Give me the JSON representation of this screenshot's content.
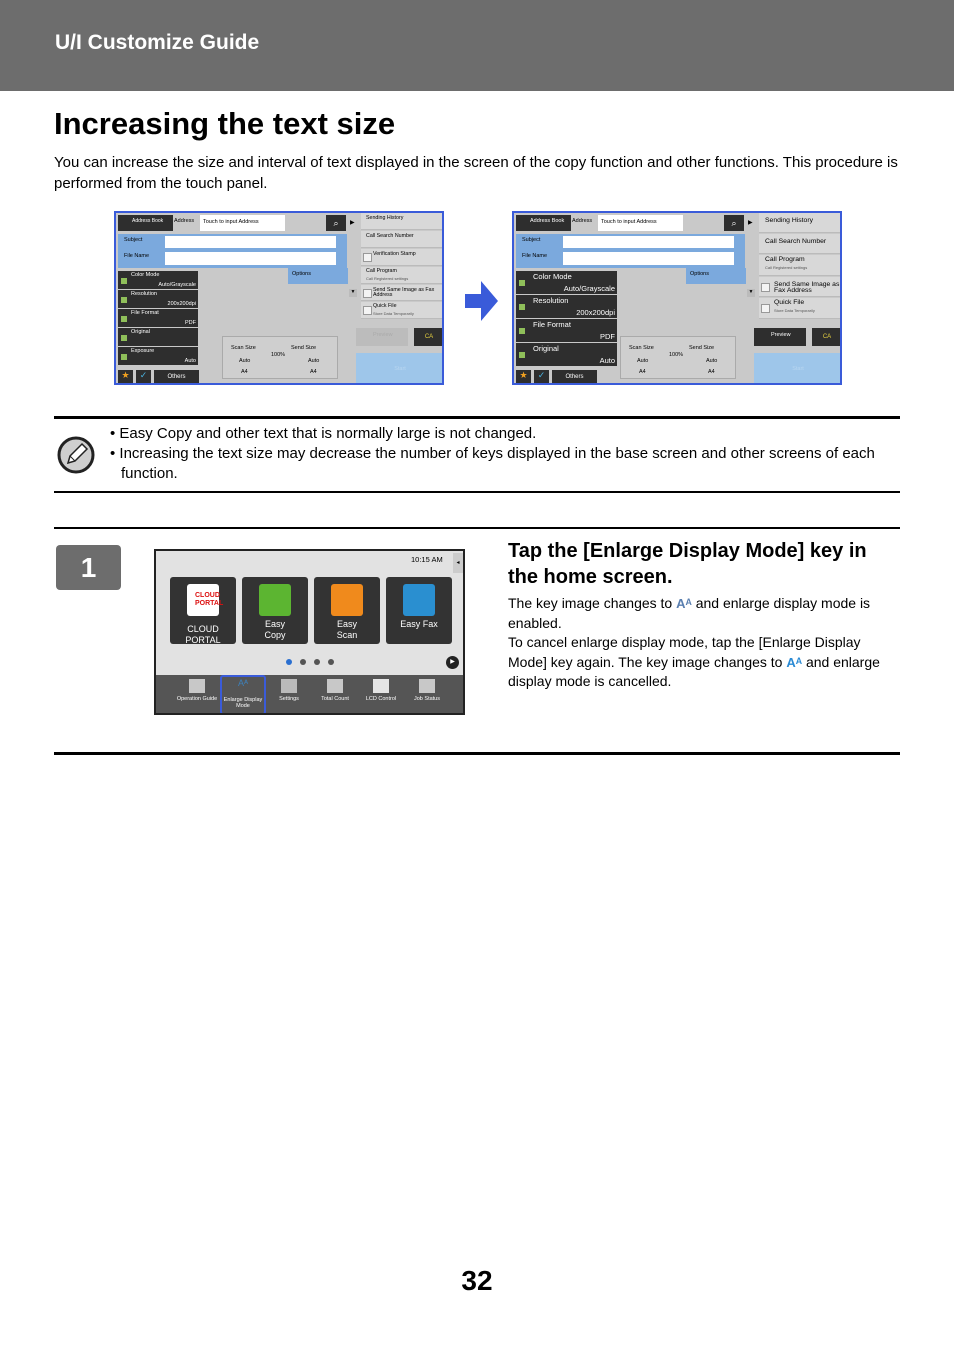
{
  "header": {
    "title": "U/I Customize Guide"
  },
  "page": {
    "title": "Increasing the text size",
    "intro": "You can increase the size and interval of text displayed in the screen of the copy function and other functions. This procedure is performed from the touch panel.",
    "number": "32"
  },
  "figures": [
    {
      "address_book": "Address Book",
      "address": "Address",
      "address_placeholder": "Touch to input Address",
      "subject": "Subject",
      "file_name": "File Name",
      "options": "Options",
      "keys": [
        {
          "label": "Color Mode",
          "value": "Auto/Grayscale"
        },
        {
          "label": "Resolution",
          "value": "200x200dpi"
        },
        {
          "label": "File Format",
          "value": "PDF"
        },
        {
          "label": "Original",
          "value": ""
        },
        {
          "label": "Exposure",
          "value": "Auto"
        }
      ],
      "others": "Others",
      "scan_size": "Scan Size",
      "send_size": "Send Size",
      "ratio": "100%",
      "scan_value": "Auto",
      "scan_paper": "A4",
      "send_value": "Auto",
      "send_paper": "A4",
      "right_items": [
        {
          "label": "Sending History",
          "sub": "",
          "check": false
        },
        {
          "label": "Call Search Number",
          "sub": "",
          "check": false
        },
        {
          "label": "Verification Stamp",
          "sub": "",
          "check": true
        },
        {
          "label": "Call Program",
          "sub": "Call Registered settings",
          "check": false
        },
        {
          "label": "Send Same Image as Fax Address",
          "sub": "",
          "check": true
        },
        {
          "label": "Quick File",
          "sub": "Store Data Temporarily",
          "check": true
        }
      ],
      "preview": "Preview",
      "preview_enabled": false,
      "ca": "CA",
      "start": "Start"
    },
    {
      "address_book": "Address Book",
      "address": "Address",
      "address_placeholder": "Touch to input Address",
      "subject": "Subject",
      "file_name": "File Name",
      "options": "Options",
      "keys": [
        {
          "label": "Color Mode",
          "value": "Auto/Grayscale"
        },
        {
          "label": "Resolution",
          "value": "200x200dpi"
        },
        {
          "label": "File Format",
          "value": "PDF"
        },
        {
          "label": "Original",
          "value": "Auto"
        }
      ],
      "others": "Others",
      "scan_size": "Scan Size",
      "send_size": "Send Size",
      "ratio": "100%",
      "scan_value": "Auto",
      "scan_paper": "A4",
      "send_value": "Auto",
      "send_paper": "A4",
      "right_items": [
        {
          "label": "Sending History",
          "sub": "",
          "check": false
        },
        {
          "label": "Call Search Number",
          "sub": "",
          "check": false
        },
        {
          "label": "Call Program",
          "sub": "Call Registered settings",
          "check": false
        },
        {
          "label": "Send Same Image as Fax Address",
          "sub": "",
          "check": true
        },
        {
          "label": "Quick File",
          "sub": "Store Data Temporarily",
          "check": true
        }
      ],
      "preview": "Preview",
      "preview_enabled": true,
      "ca": "CA",
      "start": "Start"
    }
  ],
  "notes": [
    "Easy Copy and other text that is normally large is not changed.",
    "Increasing the text size may decrease the number of keys displayed in the base screen and other screens of each function."
  ],
  "step": {
    "number": "1",
    "title": "Tap the [Enlarge Display Mode] key in the home screen.",
    "text1": "The key image changes to",
    "text2": "and enlarge display mode is enabled.",
    "text3": "To cancel enlarge display mode, tap the [Enlarge Display Mode] key again. The key image changes to",
    "text4": "and enlarge display mode is cancelled.",
    "icon_on": "Aᴬ",
    "icon_off": "Aᴬ"
  },
  "home": {
    "time": "10:15 AM",
    "tiles": [
      {
        "label": "CLOUD PORTAL",
        "logo": "CLOUD PORTAL",
        "icon": "cloud-portal-icon",
        "color": "#ffffff"
      },
      {
        "label": "Easy Copy",
        "icon": "copy-icon",
        "color": "#5cb531"
      },
      {
        "label": "Easy Scan",
        "icon": "scan-icon",
        "color": "#f08a1c"
      },
      {
        "label": "Easy Fax",
        "icon": "fax-icon",
        "color": "#2a8fd0"
      }
    ],
    "page_dots": 4,
    "active_dot": 1,
    "bottom": [
      {
        "label": "Operation Guide",
        "icon": "operation-guide-icon"
      },
      {
        "label": "Enlarge Display Mode",
        "icon": "enlarge-display-icon",
        "highlighted": true
      },
      {
        "label": "Settings",
        "icon": "settings-icon"
      },
      {
        "label": "Total Count",
        "icon": "total-count-icon"
      },
      {
        "label": "LCD Control",
        "icon": "lcd-control-icon"
      },
      {
        "label": "Job Status",
        "icon": "job-status-icon"
      }
    ]
  },
  "colors": {
    "header": "#6d6d6d",
    "highlight": "#3a5bd9",
    "blue_area": "#7ba9dd",
    "dark_key": "#2e2e2e"
  }
}
